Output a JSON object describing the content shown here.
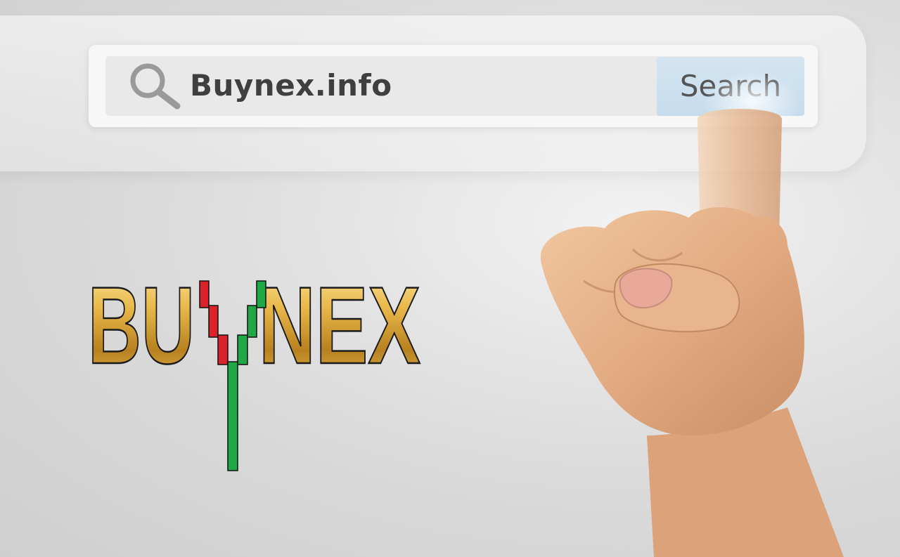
{
  "search": {
    "query": "Buynex.info",
    "button_label": "Search"
  },
  "logo": {
    "text_left": "BU",
    "text_right": "NEX",
    "alt": "BUYNEX"
  },
  "icons": {
    "search": "search-icon"
  },
  "colors": {
    "logo_gold_light": "#f3cf6a",
    "logo_gold_dark": "#9a6a14",
    "candle_red": "#d9222a",
    "candle_green": "#1fa845",
    "search_button": "#cde1ef",
    "query_text": "#3f3f3f"
  }
}
